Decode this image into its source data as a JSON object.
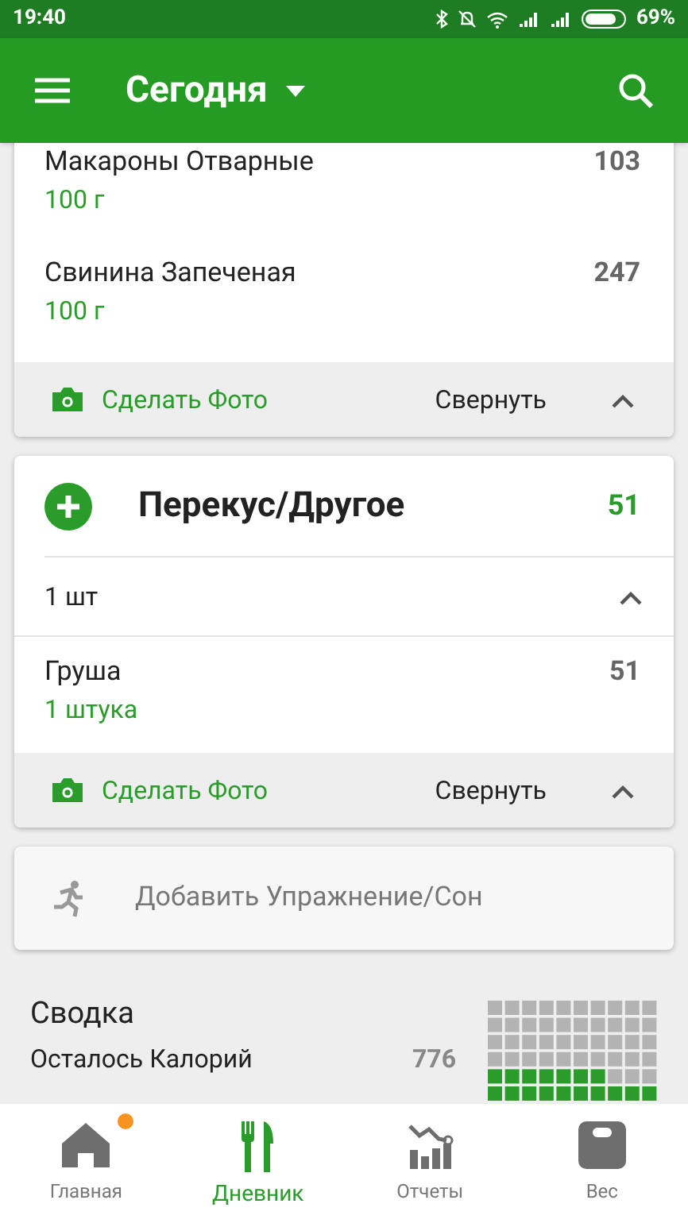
{
  "status_bar": {
    "time": "19:40",
    "battery": "69%"
  },
  "app_bar": {
    "title": "Сегодня"
  },
  "cards": [
    {
      "items": [
        {
          "name": "Макароны Отварные",
          "amount": "100 г",
          "calories": "103"
        },
        {
          "name": "Свинина Запеченая",
          "amount": "100 г",
          "calories": "247"
        }
      ],
      "footer": {
        "photo": "Сделать Фото",
        "collapse": "Свернуть",
        "expanded": true
      }
    },
    {
      "header": {
        "title": "Перекус/Другое",
        "calories": "51"
      },
      "portion": {
        "label": "1 шт",
        "expanded": true
      },
      "items": [
        {
          "name": "Груша",
          "amount": "1 штука",
          "calories": "51"
        }
      ],
      "footer": {
        "photo": "Сделать Фото",
        "collapse": "Свернуть",
        "expanded": true
      }
    }
  ],
  "exercise": {
    "label": "Добавить Упражнение/Сон"
  },
  "summary": {
    "title": "Сводка",
    "rows": [
      {
        "label": "Осталось Калорий",
        "value": "776"
      }
    ]
  },
  "nav": [
    {
      "kind": "home",
      "label": "Главная",
      "selected": false,
      "badge": true
    },
    {
      "kind": "diary",
      "label": "Дневник",
      "selected": true,
      "badge": false
    },
    {
      "kind": "reports",
      "label": "Отчеты",
      "selected": false,
      "badge": false
    },
    {
      "kind": "weight",
      "label": "Вес",
      "selected": false,
      "badge": false
    }
  ]
}
